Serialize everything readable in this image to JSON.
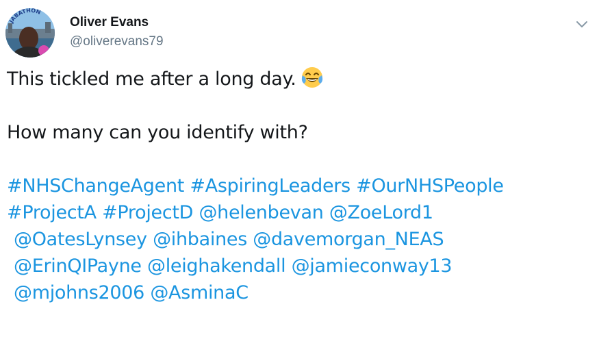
{
  "author": {
    "name": "Oliver Evans",
    "handle": "@oliverevans79",
    "avatar_badge_text": "JABATHON",
    "avatar_icon": "profile-photo"
  },
  "menu": {
    "icon": "chevron-down-icon"
  },
  "tweet": {
    "line1": "This tickled me after a long day.",
    "emoji": "face-with-tears-of-joy",
    "line2": "How many can you identify with?",
    "hashtags": [
      "#NHSChangeAgent",
      "#AspiringLeaders",
      "#OurNHSPeople",
      "#ProjectA",
      "#ProjectD"
    ],
    "mentions": [
      "@helenbevan",
      "@ZoeLord1",
      "@OatesLynsey",
      "@ihbaines",
      "@davemorgan_NEAS",
      "@ErinQIPayne",
      "@leighakendall",
      "@jamieconway13",
      "@mjohns2006",
      "@AsminaC"
    ]
  },
  "colors": {
    "link": "#1b95e0",
    "text": "#14171a",
    "muted": "#657786"
  }
}
